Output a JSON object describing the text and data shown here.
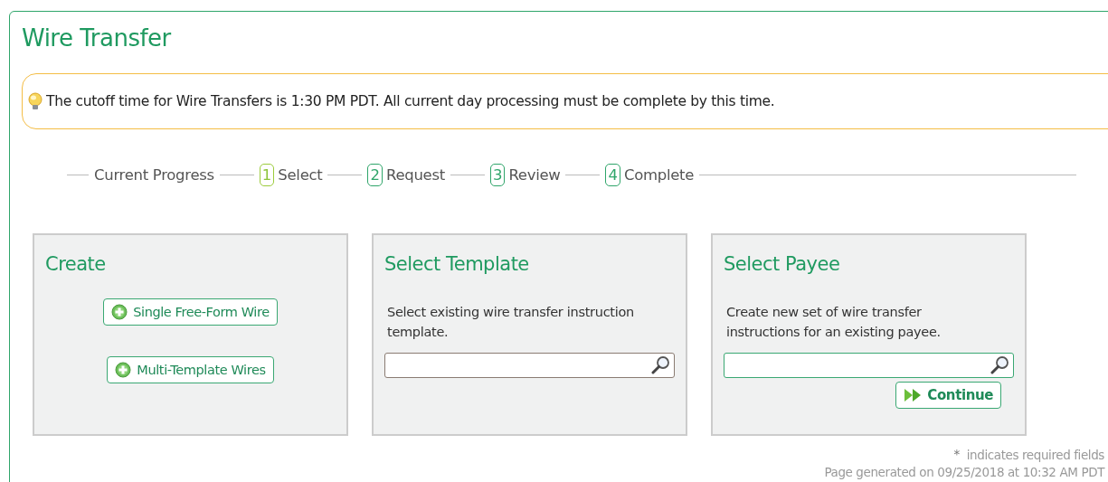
{
  "page": {
    "title": "Wire Transfer"
  },
  "notice": {
    "text": "The cutoff time for Wire Transfers is 1:30 PM PDT. All current day processing must be complete by this time."
  },
  "progress": {
    "label": "Current Progress",
    "steps": [
      {
        "number": "1",
        "label": "Select",
        "selected": true
      },
      {
        "number": "2",
        "label": "Request",
        "selected": false
      },
      {
        "number": "3",
        "label": "Review",
        "selected": false
      },
      {
        "number": "4",
        "label": "Complete",
        "selected": false
      }
    ]
  },
  "panels": [
    {
      "kind": "buttons",
      "title": "Create",
      "buttons": [
        "Single Free-Form Wire",
        "Multi-Template Wires"
      ]
    },
    {
      "kind": "search",
      "title": "Select Template",
      "description": "Select existing wire transfer instruction template.",
      "focused": false
    },
    {
      "kind": "search",
      "title": "Select Payee",
      "description": "Create new set of wire transfer instructions for an existing payee.",
      "focused": true,
      "button": "Continue"
    }
  ],
  "footer": {
    "required_mark": "*",
    "required_note": "indicates required fields",
    "generated": "Page generated on 09/25/2018 at 10:32 AM PDT"
  }
}
